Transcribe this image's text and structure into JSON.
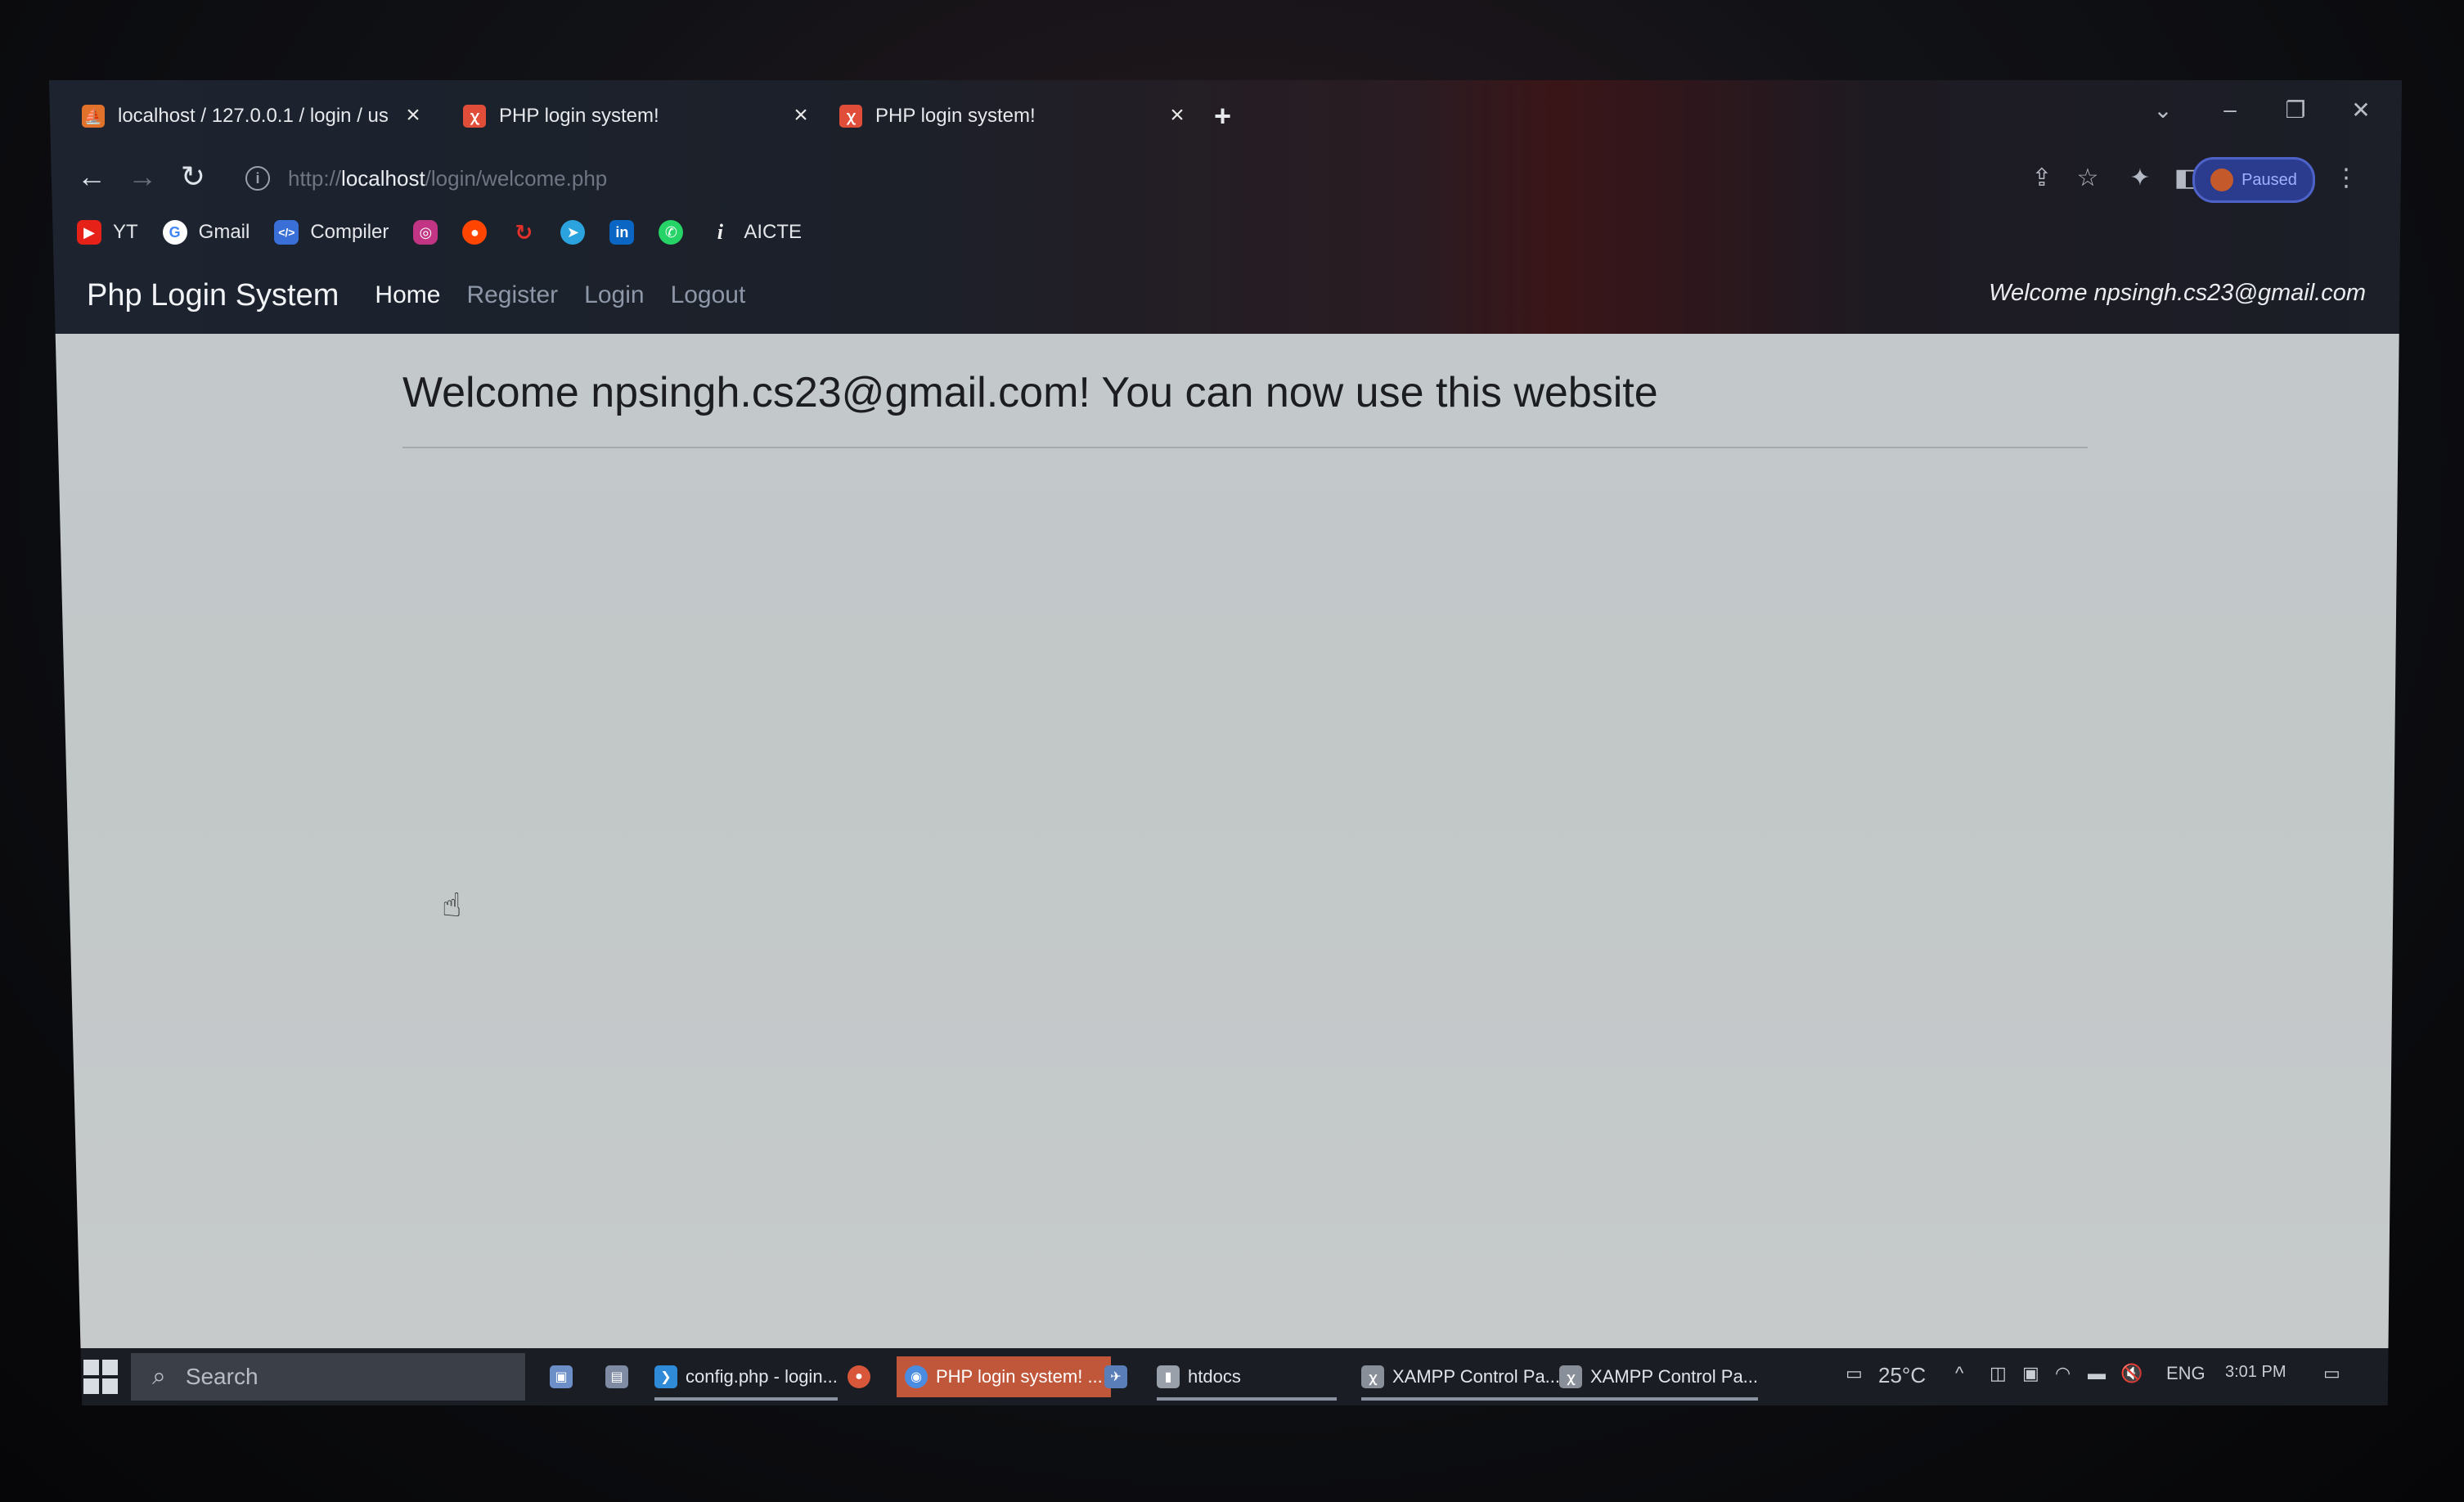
{
  "browser": {
    "tabs": [
      {
        "title": "localhost / 127.0.0.1 / login / us",
        "favicon": "phpmyadmin-icon",
        "favicon_color": "#e0722c"
      },
      {
        "title": "PHP login system!",
        "favicon": "xampp-icon",
        "favicon_color": "#e04e3a"
      },
      {
        "title": "PHP login system!",
        "favicon": "xampp-icon",
        "favicon_color": "#e04e3a"
      }
    ],
    "new_tab_label": "+",
    "url": {
      "scheme": "http://",
      "host": "localhost",
      "path": "/login/welcome.php"
    },
    "profile_status": "Paused"
  },
  "bookmarks": [
    {
      "label": "YT",
      "icon": "youtube-icon",
      "color": "#e62117"
    },
    {
      "label": "Gmail",
      "icon": "google-icon",
      "color": "#ffffff"
    },
    {
      "label": "Compiler",
      "icon": "code-icon",
      "color": "#3b6fd8"
    },
    {
      "label": "",
      "icon": "instagram-icon",
      "color": "#c13584"
    },
    {
      "label": "",
      "icon": "reddit-icon",
      "color": "#ff4500"
    },
    {
      "label": "",
      "icon": "refresh-red-icon",
      "color": "#e0302a"
    },
    {
      "label": "",
      "icon": "telegram-icon",
      "color": "#2aa3df"
    },
    {
      "label": "",
      "icon": "linkedin-icon",
      "color": "#0a66c2"
    },
    {
      "label": "",
      "icon": "whatsapp-icon",
      "color": "#25d366"
    },
    {
      "label": "AICTE",
      "icon": "info-i-icon",
      "color": "#f0f0f0"
    }
  ],
  "site": {
    "brand": "Php Login System",
    "nav": [
      "Home",
      "Register",
      "Login",
      "Logout"
    ],
    "welcome_nav": "Welcome npsingh.cs23@gmail.com",
    "heading": "Welcome npsingh.cs23@gmail.com! You can now use this website"
  },
  "taskbar": {
    "search_placeholder": "Search",
    "items": [
      {
        "label": "config.php - login...",
        "icon": "vscode-icon",
        "color": "#2f8ad8"
      },
      {
        "label": "PHP login system! ...",
        "icon": "chrome-icon",
        "color": "#4a8de0"
      },
      {
        "label": "htdocs",
        "icon": "folder-icon",
        "color": "#9aa0aa"
      },
      {
        "label": "XAMPP Control Pa...",
        "icon": "xampp-icon",
        "color": "#888f99"
      },
      {
        "label": "XAMPP Control Pa...",
        "icon": "xampp-icon",
        "color": "#888f99"
      }
    ],
    "weather": "25°C",
    "language": "ENG",
    "time": "3:01 PM"
  }
}
